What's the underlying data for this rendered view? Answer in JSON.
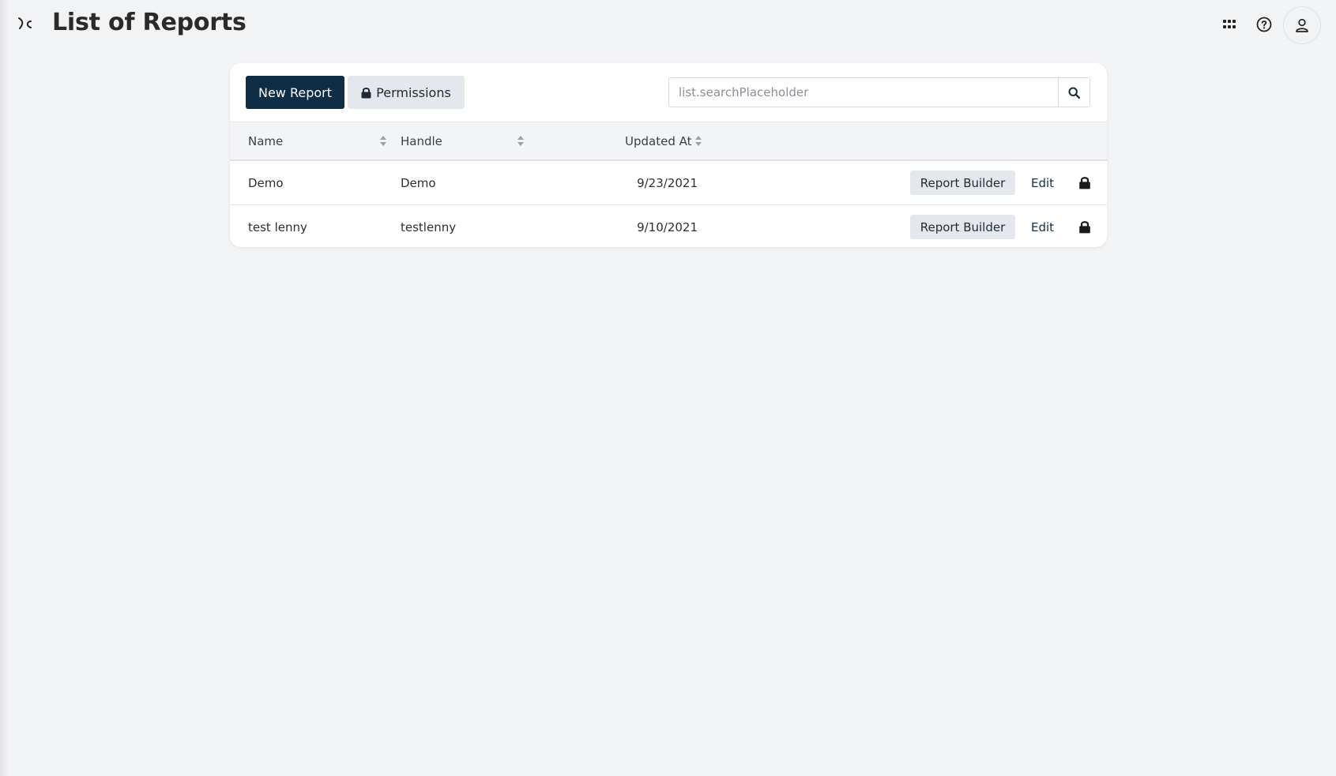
{
  "header": {
    "title": "List of Reports"
  },
  "toolbar": {
    "new_report_label": "New Report",
    "permissions_label": "Permissions"
  },
  "search": {
    "placeholder": "list.searchPlaceholder",
    "value": ""
  },
  "table": {
    "columns": [
      "Name",
      "Handle",
      "Updated At"
    ],
    "rows": [
      {
        "name": "Demo",
        "handle": "Demo",
        "updated_at": "9/23/2021",
        "builder_label": "Report Builder",
        "edit_label": "Edit"
      },
      {
        "name": "test lenny",
        "handle": "testlenny",
        "updated_at": "9/10/2021",
        "builder_label": "Report Builder",
        "edit_label": "Edit"
      }
    ]
  },
  "icons": {
    "menu": "menu-toggle-icon",
    "apps": "apps-grid-icon",
    "help": "help-icon",
    "user": "user-icon",
    "search": "search-icon",
    "lock": "lock-icon",
    "sort": "sort-icon"
  },
  "colors": {
    "primary": "#0f2d44",
    "secondary_button": "#e4e7eb",
    "background": "#f2f3f5"
  }
}
